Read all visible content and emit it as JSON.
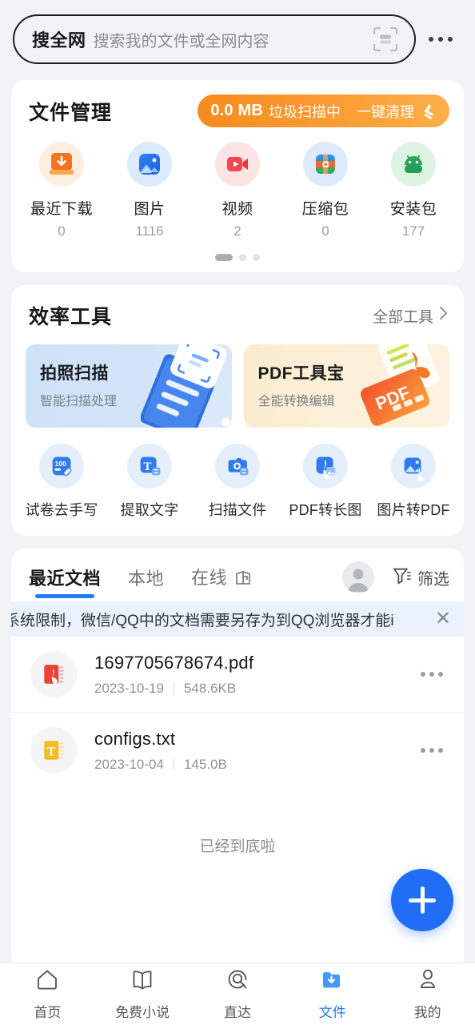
{
  "search": {
    "label": "搜全网",
    "placeholder": "搜索我的文件或全网内容",
    "scan_icon": "scan-code-icon",
    "more_icon": "more-options-icon"
  },
  "file_management": {
    "title": "文件管理",
    "clean": {
      "size": "0.0 MB",
      "status": "垃圾扫描中",
      "action": "一键清理",
      "icon": "broom-icon",
      "color": "#f9952a"
    },
    "items": [
      {
        "label": "最近下载",
        "count": "0",
        "icon": "download-icon"
      },
      {
        "label": "图片",
        "count": "1116",
        "icon": "image-icon"
      },
      {
        "label": "视频",
        "count": "2",
        "icon": "video-icon"
      },
      {
        "label": "压缩包",
        "count": "0",
        "icon": "archive-icon"
      },
      {
        "label": "安装包",
        "count": "177",
        "icon": "apk-android-icon"
      }
    ],
    "pager": {
      "count": 3,
      "active": 0
    }
  },
  "efficiency_tools": {
    "title": "效率工具",
    "all_tools_label": "全部工具",
    "all_tools_chevron": "chevron-right-icon",
    "banners": [
      {
        "title": "拍照扫描",
        "subtitle": "智能扫描处理",
        "art": "scan-document-art"
      },
      {
        "title": "PDF工具宝",
        "subtitle": "全能转换编辑",
        "art": "pdf-tool-art"
      }
    ],
    "tools": [
      {
        "label": "试卷去手写",
        "icon": "exam-erase-handwriting-icon"
      },
      {
        "label": "提取文字",
        "icon": "extract-text-icon"
      },
      {
        "label": "扫描文件",
        "icon": "scan-file-camera-icon"
      },
      {
        "label": "PDF转长图",
        "icon": "pdf-to-longimage-icon"
      },
      {
        "label": "图片转PDF",
        "icon": "image-to-pdf-icon"
      }
    ]
  },
  "documents": {
    "tabs": [
      {
        "label": "最近文档",
        "active": true,
        "badge": null
      },
      {
        "label": "本地",
        "active": false,
        "badge": null
      },
      {
        "label": "在线",
        "active": false,
        "badge": "cloud-box-icon"
      }
    ],
    "avatar_icon": "user-avatar-icon",
    "filter": {
      "label": "筛选",
      "icon": "filter-funnel-icon"
    },
    "notice": {
      "text": "系统限制，微信/QQ中的文档需要另存为到QQ浏览器才能i",
      "close_icon": "close-icon",
      "background": "#eaf2fe"
    },
    "files": [
      {
        "name": "1697705678674.pdf",
        "date": "2023-10-19",
        "size": "548.6KB",
        "icon": "pdf-file-icon",
        "icon_color": "#ea4335",
        "more_icon": "more-options-icon"
      },
      {
        "name": "configs.txt",
        "date": "2023-10-04",
        "size": "145.0B",
        "icon": "txt-file-icon",
        "icon_color": "#f5bb27",
        "more_icon": "more-options-icon"
      }
    ],
    "end_text": "已经到底啦"
  },
  "fab": {
    "icon": "plus-icon",
    "color": "#1f6ef5"
  },
  "bottom_nav": {
    "items": [
      {
        "label": "首页",
        "icon": "home-icon",
        "active": false
      },
      {
        "label": "免费小说",
        "icon": "book-icon",
        "active": false
      },
      {
        "label": "直达",
        "icon": "direct-go-icon",
        "active": false
      },
      {
        "label": "文件",
        "icon": "folder-download-icon",
        "active": true
      },
      {
        "label": "我的",
        "icon": "person-icon",
        "active": false
      }
    ],
    "active_color": "#1f7bf4"
  }
}
